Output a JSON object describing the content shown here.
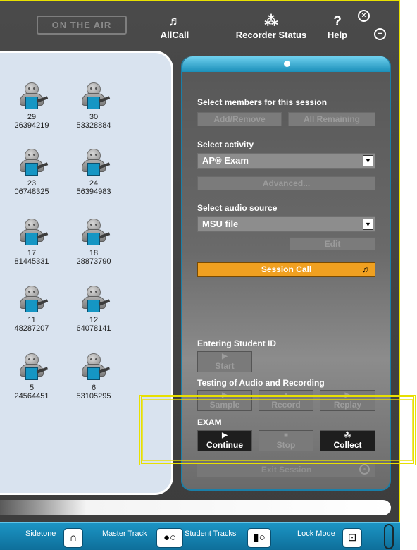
{
  "topbar": {
    "on_air": "ON THE AIR",
    "allcall": {
      "label": "AllCall",
      "icon": "allcall-icon"
    },
    "recorder_status": {
      "label": "Recorder Status",
      "icon": "recorder-status-icon"
    },
    "help": {
      "label": "Help",
      "icon": "help-icon"
    },
    "close_glyph": "⊗",
    "minimize_glyph": "⊖"
  },
  "seats": [
    {
      "number": "29",
      "id": "26394219"
    },
    {
      "number": "30",
      "id": "53328884"
    },
    {
      "number": "23",
      "id": "06748325"
    },
    {
      "number": "24",
      "id": "56394983"
    },
    {
      "number": "17",
      "id": "81445331"
    },
    {
      "number": "18",
      "id": "28873790"
    },
    {
      "number": "11",
      "id": "48287207"
    },
    {
      "number": "12",
      "id": "64078141"
    },
    {
      "number": "5",
      "id": "24564451"
    },
    {
      "number": "6",
      "id": "53105295"
    }
  ],
  "panel": {
    "select_members_label": "Select members for this session",
    "add_remove_label": "Add/Remove",
    "all_remaining_label": "All Remaining",
    "select_activity_label": "Select activity",
    "activity_value": "AP® Exam",
    "advanced_label": "Advanced...",
    "select_audio_label": "Select audio source",
    "audio_value": "MSU file",
    "edit_label": "Edit",
    "session_call_label": "Session Call",
    "entering_id_label": "Entering Student ID",
    "start_label": "Start",
    "testing_label": "Testing of Audio and Recording",
    "sample_label": "Sample",
    "record_label": "Record",
    "replay_label": "Replay",
    "exam_label": "EXAM",
    "continue_label": "Continue",
    "stop_label": "Stop",
    "collect_label": "Collect",
    "exit_label": "Exit Session"
  },
  "bottombar": {
    "sidetone_label": "Sidetone",
    "master_track_label": "Master Track",
    "student_tracks_label": "Student Tracks",
    "lock_mode_label": "Lock Mode"
  },
  "colors": {
    "accent": "#1a8fb9",
    "session_call": "#f0a020",
    "seat_screen": "#1596c4",
    "highlight": "#e8e000"
  }
}
